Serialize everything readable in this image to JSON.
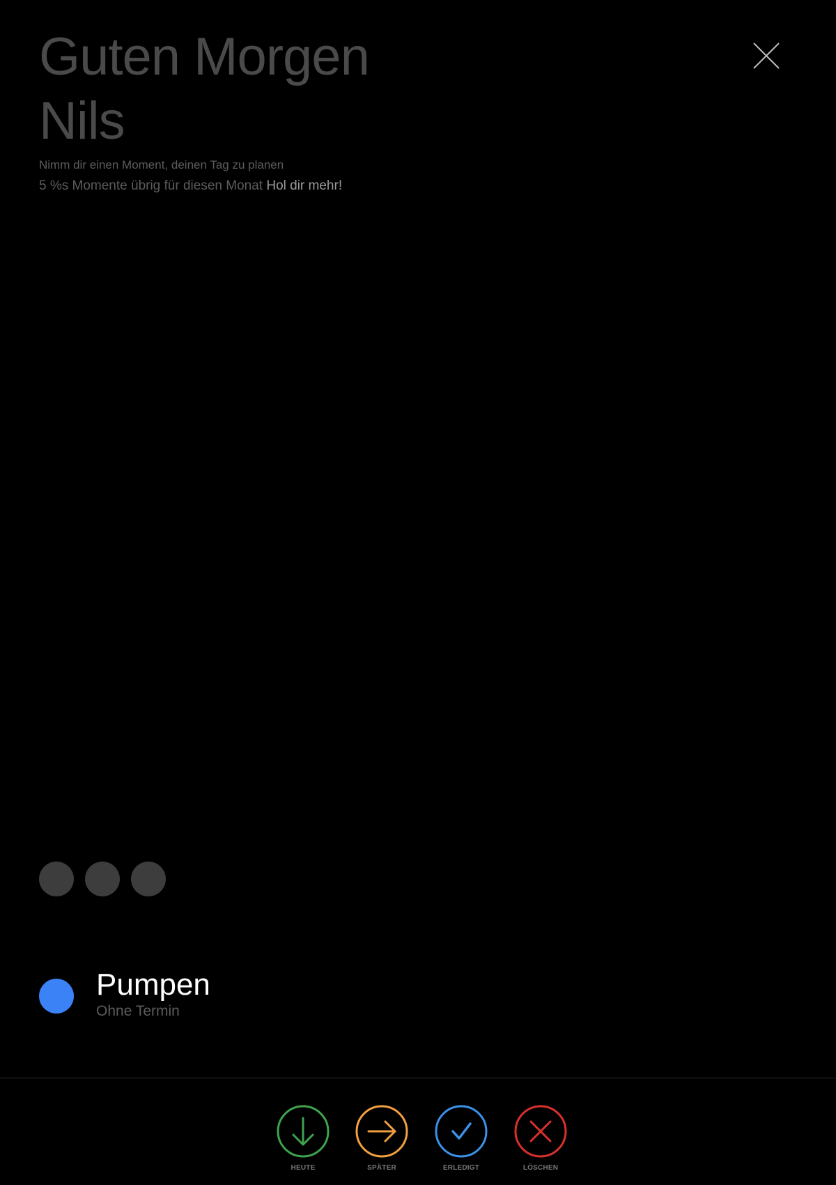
{
  "header": {
    "greeting_line1": "Guten Morgen",
    "greeting_line2": "Nils",
    "close_icon": "close-icon"
  },
  "intro": {
    "subtitle": "Nimm dir einen Moment, deinen Tag zu planen",
    "quota_text": "5 %s Momente übrig für diesen Monat",
    "more_link": "Hol dir mehr!"
  },
  "progress_dots": {
    "count": 3,
    "color": "#3d3d3d"
  },
  "task": {
    "title": "Pumpen",
    "subtitle": "Ohne Termin",
    "color": "#3a82f6"
  },
  "actions": [
    {
      "label": "HEUTE",
      "icon": "arrow-down-icon",
      "color": "#3fa34d"
    },
    {
      "label": "SPÄTER",
      "icon": "arrow-right-icon",
      "color": "#f0a040"
    },
    {
      "label": "ERLEDIGT",
      "icon": "check-icon",
      "color": "#3b92e8"
    },
    {
      "label": "LÖSCHEN",
      "icon": "x-icon",
      "color": "#d9302c"
    }
  ]
}
